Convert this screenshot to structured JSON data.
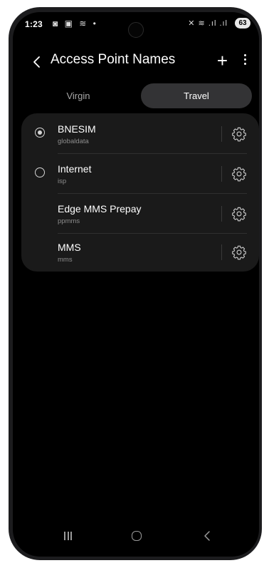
{
  "status": {
    "time": "1:23",
    "left_icons": "◙ ▣ ≋ •",
    "right_icons": "✕ ≋ .ıl .ıl",
    "battery": "63"
  },
  "appbar": {
    "title": "Access Point Names",
    "add_icon": "+"
  },
  "tabs": [
    {
      "label": "Virgin"
    },
    {
      "label": "Travel"
    }
  ],
  "apns": [
    {
      "name": "BNESIM",
      "apn": "globaldata",
      "selected": true
    },
    {
      "name": "Internet",
      "apn": "isp",
      "selected": false
    },
    {
      "name": "Edge MMS Prepay",
      "apn": "ppmms",
      "selected": null
    },
    {
      "name": "MMS",
      "apn": "mms",
      "selected": null
    }
  ],
  "colors": {
    "background": "#000000",
    "card": "#1a1a1a",
    "active_tab": "#333335",
    "subtext": "#8d8d8d"
  }
}
